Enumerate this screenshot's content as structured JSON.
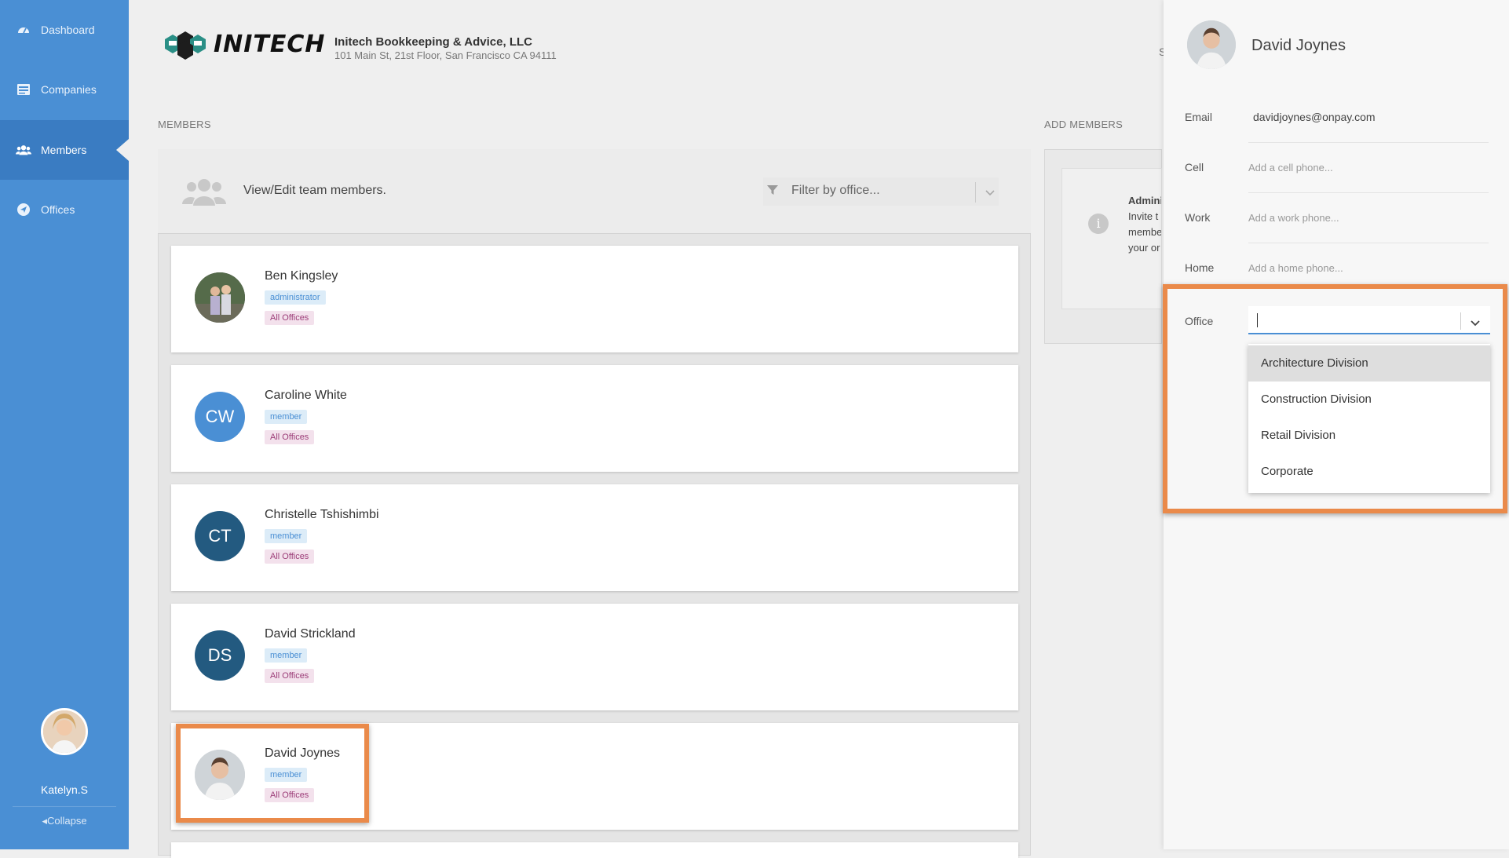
{
  "sidebar": {
    "items": [
      {
        "label": "Dashboard",
        "icon": "dashboard-icon"
      },
      {
        "label": "Companies",
        "icon": "companies-icon"
      },
      {
        "label": "Members",
        "icon": "members-icon"
      },
      {
        "label": "Offices",
        "icon": "offices-icon"
      }
    ],
    "user": {
      "name": "Katelyn.S"
    },
    "collapse_label": "Collapse"
  },
  "header": {
    "logo_text": "INITECH",
    "company_name": "Initech Bookkeeping & Advice, LLC",
    "company_address": "101 Main St, 21st Floor, San Francisco CA 94111",
    "partial_text": "S"
  },
  "members": {
    "section_label": "MEMBERS",
    "header_text": "View/Edit team members.",
    "filter_placeholder": "Filter by office...",
    "list": [
      {
        "name": "Ben Kingsley",
        "role": "administrator",
        "office": "All Offices",
        "initials": "",
        "avatar_color": "#3b3b3b"
      },
      {
        "name": "Caroline White",
        "role": "member",
        "office": "All Offices",
        "initials": "CW",
        "avatar_color": "#4a8fd4"
      },
      {
        "name": "Christelle Tshishimbi",
        "role": "member",
        "office": "All Offices",
        "initials": "CT",
        "avatar_color": "#235a80"
      },
      {
        "name": "David Strickland",
        "role": "member",
        "office": "All Offices",
        "initials": "DS",
        "avatar_color": "#235a80"
      },
      {
        "name": "David Joynes",
        "role": "member",
        "office": "All Offices",
        "initials": "",
        "avatar_color": "#cfd4d8"
      }
    ]
  },
  "add_members": {
    "section_label": "ADD MEMBERS",
    "text_lines": [
      "Admini",
      "Invite t",
      "membe",
      "your or"
    ]
  },
  "drawer": {
    "name": "David Joynes",
    "fields": {
      "email_label": "Email",
      "email_value": "davidjoynes@onpay.com",
      "cell_label": "Cell",
      "cell_placeholder": "Add a cell phone...",
      "work_label": "Work",
      "work_placeholder": "Add a work phone...",
      "home_label": "Home",
      "home_placeholder": "Add a home phone...",
      "office_label": "Office",
      "office_value": ""
    },
    "office_options": [
      "Architecture Division",
      "Construction Division",
      "Retail Division",
      "Corporate"
    ],
    "highlighted_option": "Architecture Division"
  },
  "colors": {
    "sidebar": "#4a8fd4",
    "sidebar_active": "#3a7cc2",
    "highlight": "#ea8a4a",
    "role_badge": "#dcecf8",
    "office_badge": "#f3e1ec"
  }
}
